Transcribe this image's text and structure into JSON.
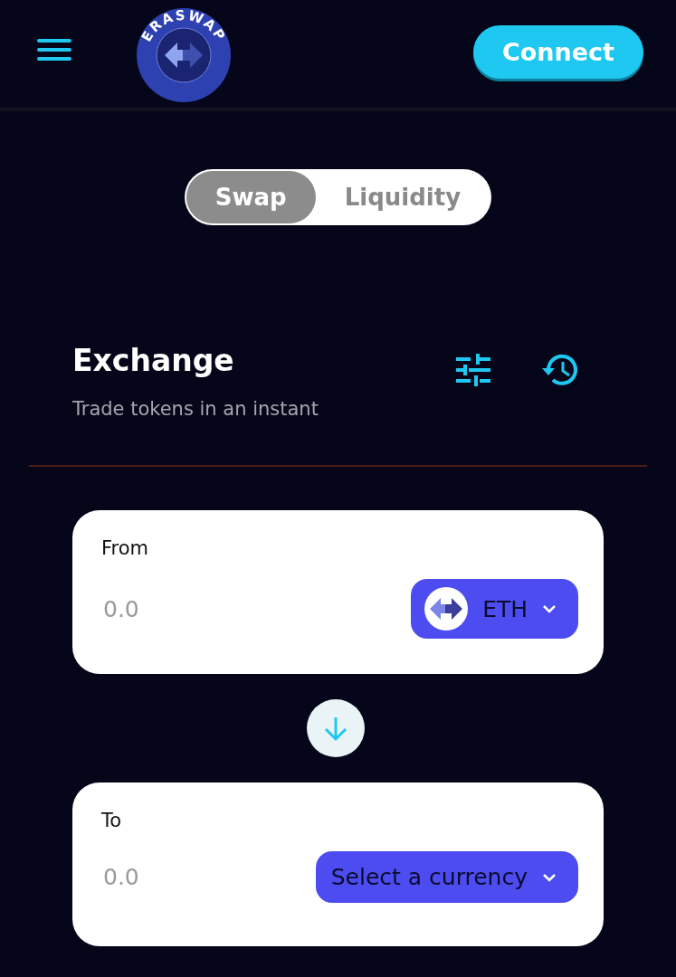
{
  "header": {
    "logo_text": "ERASWAP",
    "connect_button": "Connect"
  },
  "tabs": [
    {
      "label": "Swap",
      "selected": true
    },
    {
      "label": "Liquidity",
      "selected": false
    }
  ],
  "exchange": {
    "title": "Exchange",
    "subtitle": "Trade tokens in an instant"
  },
  "from": {
    "label": "From",
    "placeholder": "0.0",
    "token": {
      "kind": "token",
      "label": "ETH"
    }
  },
  "to": {
    "label": "To",
    "placeholder": "0.0",
    "token": {
      "kind": "select",
      "label": "Select a currency"
    }
  }
}
